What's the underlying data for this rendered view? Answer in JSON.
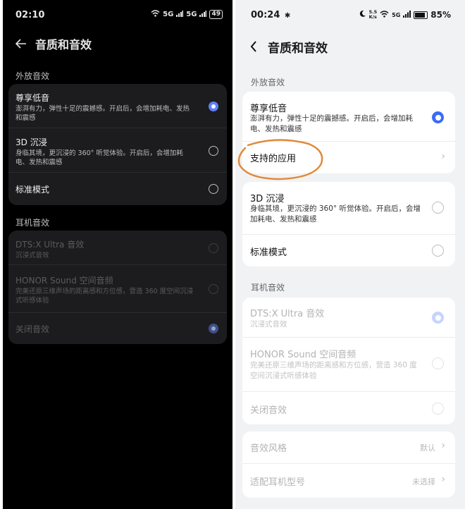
{
  "left": {
    "status": {
      "time": "02:10",
      "battery": "49",
      "signal_left": "5G",
      "signal_right": "5G"
    },
    "header": {
      "title": "音质和音效"
    },
    "speaker_section": "外放音效",
    "speaker_items": [
      {
        "title": "尊享低音",
        "desc": "澎湃有力，弹性十足的震撼感。开启后，会增加耗电、发热和震感",
        "selected": true
      },
      {
        "title": "3D 沉浸",
        "desc": "身临其境，更沉浸的 360° 听觉体验。开启后，会增加耗电、发热和震感",
        "selected": false
      },
      {
        "title": "标准模式",
        "selected": false
      }
    ],
    "headphone_section": "耳机音效",
    "headphone_items": [
      {
        "title": "DTS:X Ultra 音效",
        "desc": "沉浸式音效",
        "selected": false
      },
      {
        "title": "HONOR Sound 空间音频",
        "desc": "完美还原三维声场的距离感和方位感，营造 360 度空间沉浸式听感体验",
        "selected": false
      },
      {
        "title": "关闭音效",
        "selected": true
      }
    ]
  },
  "right": {
    "status": {
      "time": "00:24",
      "battery": "85%",
      "speed_top": "5.5",
      "speed_unit": "K/s",
      "signal": "5G"
    },
    "header": {
      "title": "音质和音效"
    },
    "speaker_section": "外放音效",
    "bass": {
      "title": "尊享低音",
      "desc": "澎湃有力，弹性十足的震撼感。开启后，会增加耗电、发热和震感",
      "selected": true
    },
    "supported_apps": {
      "title": "支持的应用"
    },
    "speaker_items": [
      {
        "title": "3D 沉浸",
        "desc": "身临其境，更沉浸的 360° 听觉体验。开启后，会增加耗电、发热和震感",
        "selected": false
      },
      {
        "title": "标准模式",
        "selected": false
      }
    ],
    "headphone_section": "耳机音效",
    "headphone_items": [
      {
        "title": "DTS:X Ultra 音效",
        "desc": "沉浸式音效",
        "selected": true
      },
      {
        "title": "HONOR Sound 空间音频",
        "desc": "完美还原三维声场的距离感和方位感，营造 360 度空间沉浸式听感体验",
        "selected": false
      },
      {
        "title": "关闭音效",
        "selected": false
      }
    ],
    "effect_style": {
      "title": "音效风格",
      "value": "默认"
    },
    "earphone_model": {
      "title": "适配耳机型号",
      "value": "未选择"
    }
  },
  "colors": {
    "accent_left": "#5f7fff",
    "accent_right": "#3b6cf5",
    "annotation": "#e08a3a"
  }
}
